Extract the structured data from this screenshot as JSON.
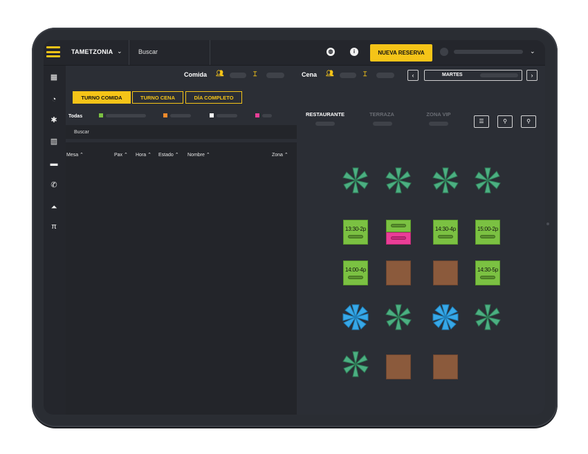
{
  "topbar": {
    "brand": "TAMETZONIA",
    "search_label": "Buscar",
    "new_reservation": "NUEVA RESERVA",
    "chevron": "⌄"
  },
  "service": {
    "comida_label": "Comida",
    "cena_label": "Cena",
    "day_label": "MARTES",
    "prev": "‹",
    "next": "›"
  },
  "tabs": [
    {
      "label": "TURNO COMIDA",
      "active": true
    },
    {
      "label": "TURNO CENA",
      "active": false
    },
    {
      "label": "DÍA COMPLETO",
      "active": false
    }
  ],
  "filters": {
    "all_label": "Todas",
    "legend_colors": [
      "#7bc142",
      "#f08a2c",
      "#ffffff",
      "#ea3e97"
    ]
  },
  "list": {
    "search_label": "Buscar",
    "columns": [
      "Mesa ⌃",
      "Pax ⌃",
      "Hora ⌃",
      "Estado ⌃",
      "Nombre ⌃",
      "Zona ⌃"
    ]
  },
  "zones": [
    {
      "label": "RESTAURANTE",
      "active": true
    },
    {
      "label": "TERRAZA",
      "active": false
    },
    {
      "label": "ZONA VIP",
      "active": false
    }
  ],
  "tools": [
    "list-icon",
    "zoom-in-icon",
    "zoom-out-icon"
  ],
  "floor": {
    "tables": [
      {
        "label": "13:30-2p",
        "status": "green"
      },
      {
        "label": "",
        "status": "split"
      },
      {
        "label": "14:30-4p",
        "status": "green"
      },
      {
        "label": "15:00-2p",
        "status": "green"
      },
      {
        "label": "14:00-4p",
        "status": "green"
      },
      {
        "label": "",
        "status": "brown"
      },
      {
        "label": "",
        "status": "brown"
      },
      {
        "label": "14:30-5p",
        "status": "green"
      },
      {
        "label": "",
        "status": "brown"
      },
      {
        "label": "",
        "status": "brown"
      }
    ],
    "colors": {
      "plant": "#4caf82",
      "umbrella": "#37a8e8",
      "accent": "#f5c418"
    }
  }
}
